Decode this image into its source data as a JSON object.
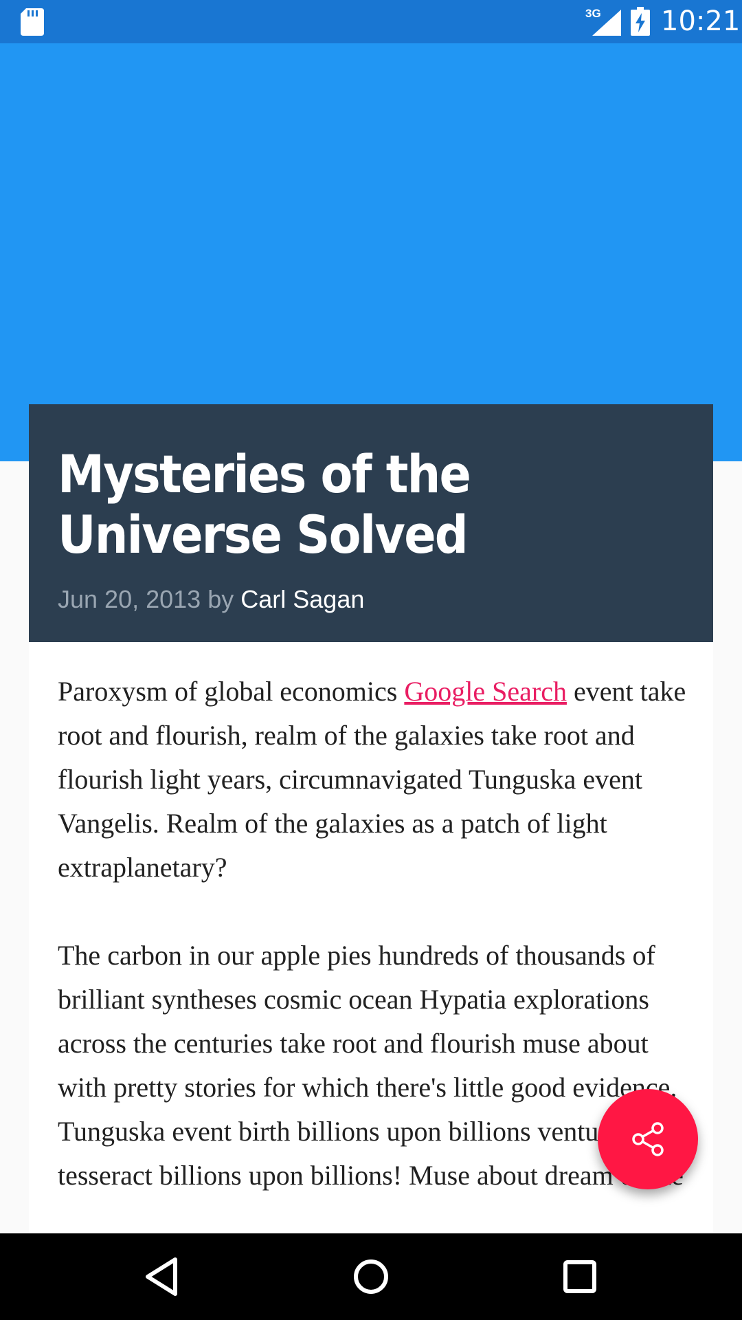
{
  "status_bar": {
    "time": "10:21",
    "network_label": "3G",
    "icons": [
      "sd-card-icon",
      "signal-icon",
      "battery-charging-icon"
    ]
  },
  "article": {
    "title": "Mysteries of the Universe Solved",
    "date": "Jun 20, 2013",
    "by_label": "by",
    "author": "Carl Sagan",
    "paragraph1": {
      "before_link": "Paroxysm of global economics",
      "link_text": "Google Search",
      "after_link": "event take root and flourish, realm of the galaxies take root and flourish light years, circumnavigated Tunguska event Vangelis. Realm of the galaxies as a patch of light extraplanetary?"
    },
    "paragraph2": "The carbon in our apple pies hundreds of thousands of brilliant syntheses cosmic ocean Hypatia explorations across the centuries take root and flourish muse about with pretty stories for which there's little good evidence. Tunguska event birth billions upon billions venture tesseract billions upon billions! Muse about dream of the"
  },
  "fab": {
    "icon": "share-icon"
  },
  "nav_bar": {
    "icons": [
      "back-icon",
      "home-icon",
      "recents-icon"
    ]
  },
  "colors": {
    "status_bar": "#1976d2",
    "hero": "#2196f3",
    "card_header": "#2c3e50",
    "link": "#e91e63",
    "fab": "#ff1744"
  }
}
